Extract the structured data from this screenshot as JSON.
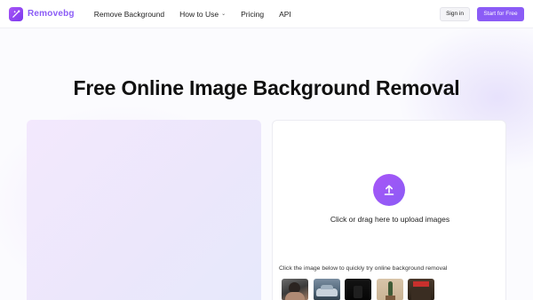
{
  "header": {
    "brand": "Removebg",
    "nav": [
      {
        "label": "Remove Background"
      },
      {
        "label": "How to Use",
        "has_dropdown": true
      },
      {
        "label": "Pricing"
      },
      {
        "label": "API"
      }
    ],
    "signin_label": "Sign in",
    "start_label": "Start for Free"
  },
  "main": {
    "title": "Free Online Image Background Removal",
    "upload": {
      "prompt": "Click or drag here to upload images",
      "icon": "upload-arrow-icon"
    },
    "samples": {
      "hint": "Click the image below to quickly try online background removal",
      "items": [
        {
          "name": "sample-person"
        },
        {
          "name": "sample-car"
        },
        {
          "name": "sample-dark-object"
        },
        {
          "name": "sample-plant"
        },
        {
          "name": "sample-product"
        }
      ]
    }
  },
  "colors": {
    "accent": "#8b5cf6",
    "accent_light": "#a855f7",
    "title_text": "#111111"
  }
}
